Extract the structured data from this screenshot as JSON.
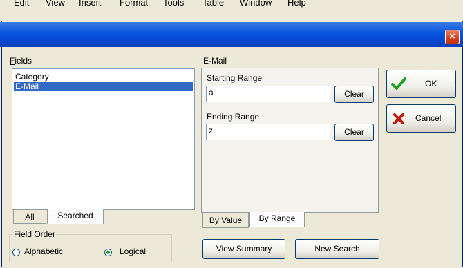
{
  "menubar": {
    "items": [
      "Edit",
      "View",
      "Insert",
      "Format",
      "Tools",
      "Table",
      "Window",
      "Help"
    ]
  },
  "dialog": {
    "close_label": "×",
    "fields": {
      "label": "Fields",
      "items": [
        {
          "label": "Category",
          "selected": false
        },
        {
          "label": "E-Mail",
          "selected": true
        }
      ],
      "tabs": {
        "all": "All",
        "searched": "Searched",
        "active": "searched"
      }
    },
    "field_order": {
      "label": "Field Order",
      "options": [
        {
          "label": "Alphabetic",
          "checked": false
        },
        {
          "label": "Logical",
          "checked": true
        }
      ]
    },
    "range": {
      "field_label": "E-Mail",
      "starting_label": "Starting Range",
      "starting_value": "a",
      "ending_label": "Ending Range",
      "ending_value": "z",
      "clear_label": "Clear",
      "tabs": {
        "by_value": "By Value",
        "by_range": "By Range",
        "active": "by_range"
      }
    },
    "buttons": {
      "ok": "OK",
      "cancel": "Cancel",
      "view_summary": "View Summary",
      "new_search": "New Search"
    },
    "colors": {
      "title_bar": "#0548d6",
      "selection": "#316ac5",
      "ok_check": "#21a121",
      "cancel_x": "#c0170e"
    }
  }
}
